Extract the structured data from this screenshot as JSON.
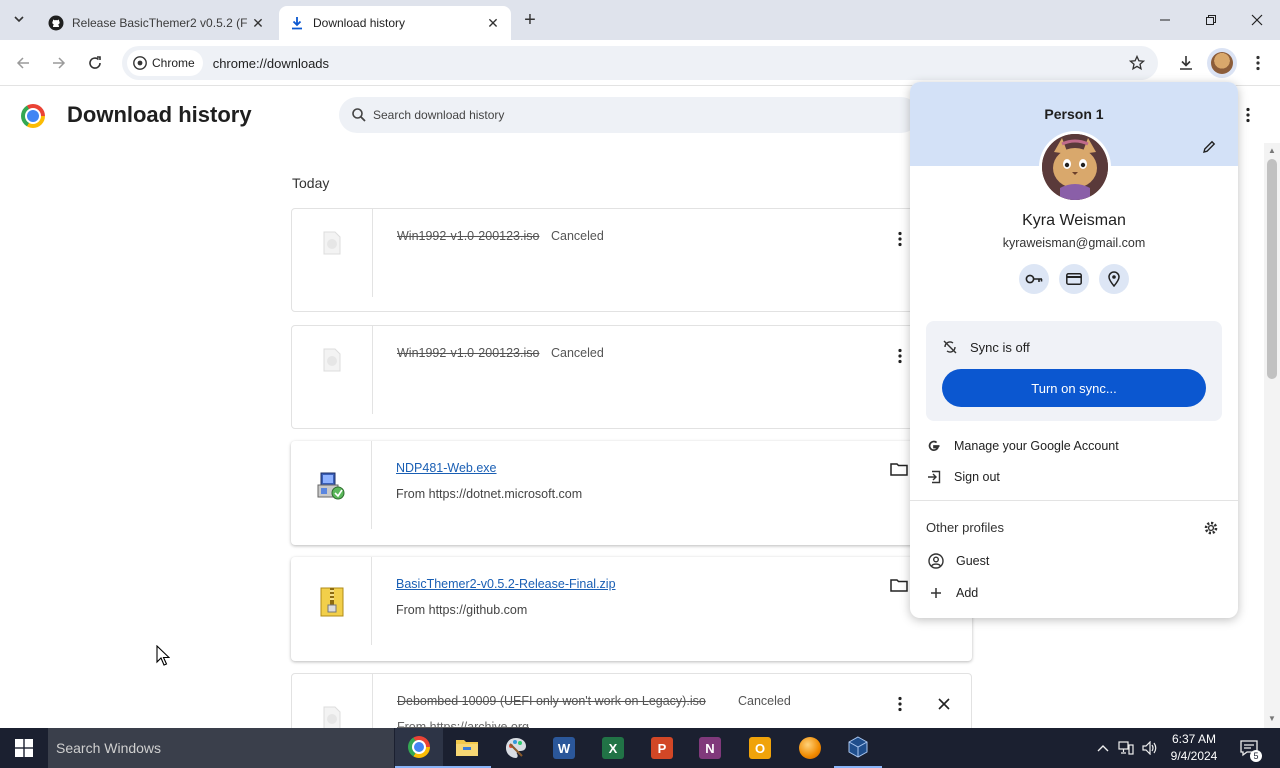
{
  "tabs": [
    {
      "title": "Release BasicThemer2 v0.5.2 (F",
      "active": false
    },
    {
      "title": "Download history",
      "active": true
    }
  ],
  "omnibox": {
    "chip": "Chrome",
    "url": "chrome://downloads"
  },
  "page": {
    "title": "Download history",
    "search_placeholder": "Search download history",
    "section": "Today"
  },
  "downloads": [
    {
      "name": "Win1992-v1.0-200123.iso",
      "status": "Canceled",
      "from": ""
    },
    {
      "name": "Win1992-v1.0-200123.iso",
      "status": "Canceled",
      "from": ""
    },
    {
      "name": "NDP481-Web.exe",
      "status": "",
      "from": "From https://dotnet.microsoft.com"
    },
    {
      "name": "BasicThemer2-v0.5.2-Release-Final.zip",
      "status": "",
      "from": "From https://github.com"
    },
    {
      "name": "Debombed 10009 (UEFI only won't work on Legacy).iso",
      "status": "Canceled",
      "from": "From https://archive.org"
    }
  ],
  "profile": {
    "title": "Person 1",
    "name": "Kyra Weisman",
    "email": "kyraweisman@gmail.com",
    "sync_status": "Sync is off",
    "sync_button": "Turn on sync...",
    "manage_account": "Manage your Google Account",
    "sign_out": "Sign out",
    "other_profiles": "Other profiles",
    "guest": "Guest",
    "add": "Add"
  },
  "taskbar": {
    "search_placeholder": "Search Windows",
    "time": "6:37 AM",
    "date": "9/4/2024",
    "notifications": "5"
  },
  "colors": {
    "accent": "#0b57d0",
    "tabstrip": "#dfe3ec",
    "banner": "#d3e1f7",
    "taskbar": "#1b2030"
  }
}
